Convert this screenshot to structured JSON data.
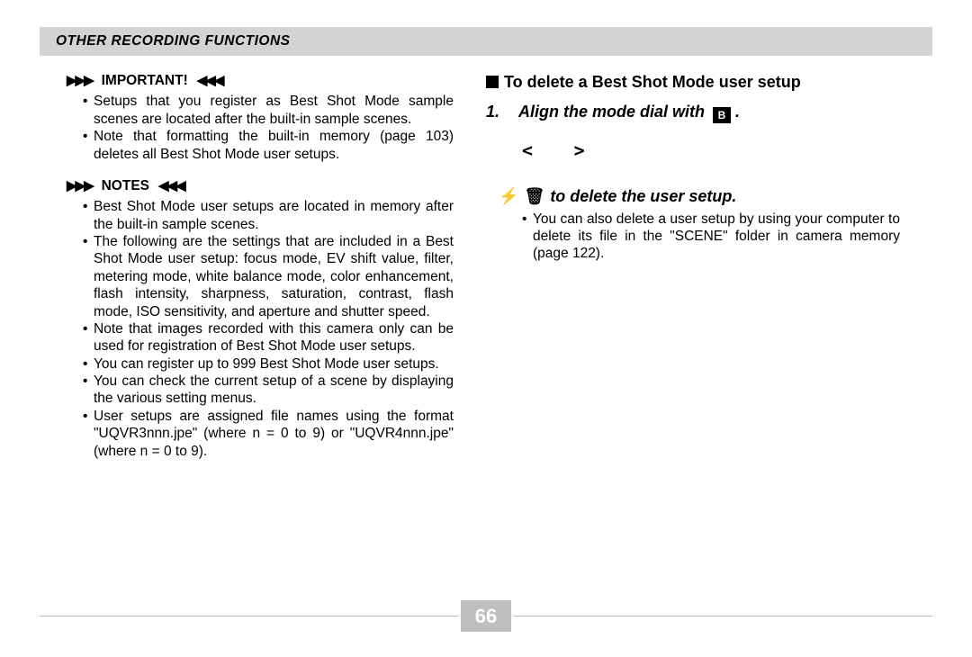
{
  "header": {
    "title": "OTHER RECORDING FUNCTIONS"
  },
  "left": {
    "important_label": "IMPORTANT!",
    "important_items": [
      "Setups that you register as Best Shot Mode sample scenes are located after the built-in sample scenes.",
      "Note that formatting the built-in memory (page 103) deletes all Best Shot Mode user setups."
    ],
    "notes_label": "NOTES",
    "notes_items": [
      "Best Shot Mode user setups are located in memory after the built-in sample scenes.",
      "The following are the settings that are included in a Best Shot Mode user setup: focus mode, EV shift value, filter, metering mode, white balance mode, color enhancement, flash intensity, sharpness, saturation, contrast, flash mode, ISO sensitivity, and aperture and shutter speed.",
      "Note that images recorded with this camera only can be used for registration of Best Shot Mode user setups.",
      "You can register up to 999 Best Shot Mode user setups.",
      "You can check the current setup of a scene by displaying the various setting menus.",
      "User setups are assigned file names using the format \"UQVR3nnn.jpe\" (where n = 0 to 9) or \"UQVR4nnn.jpe\" (where n = 0 to 9)."
    ]
  },
  "right": {
    "heading": "To delete a Best Shot Mode user setup",
    "step1_num": "1.",
    "step1_text": "Align the mode dial with",
    "step1_icon_letter": "B",
    "step3_text": "to delete the user setup.",
    "sub_bullets": [
      "You can also delete a user setup by using your computer to delete its file in the \"SCENE\" folder in camera memory (page 122)."
    ]
  },
  "page_number": "66"
}
